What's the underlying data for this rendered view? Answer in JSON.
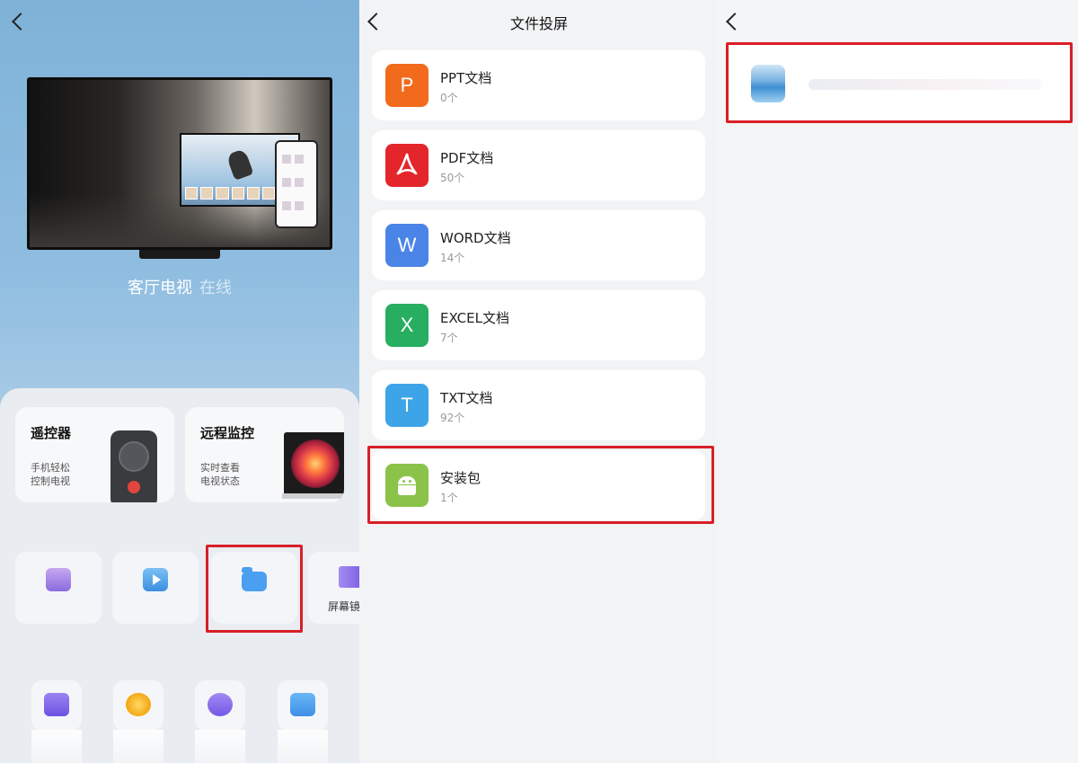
{
  "panel1": {
    "device": {
      "name": "客厅电视",
      "status": "在线"
    },
    "cards": [
      {
        "title": "遥控器",
        "subtitle_lines": [
          "手机轻松",
          "控制电视"
        ]
      },
      {
        "title": "远程监控",
        "subtitle_lines": [
          "实时查看",
          "电视状态"
        ]
      }
    ],
    "tiles": [
      {
        "icon": "image-icon",
        "label": ""
      },
      {
        "icon": "video-play-icon",
        "label": ""
      },
      {
        "icon": "folder-icon",
        "label": ""
      },
      {
        "icon": "screen-mirror-icon",
        "label": "屏幕镜"
      }
    ],
    "shortcuts": [
      {
        "icon": "tv-screen-icon"
      },
      {
        "icon": "magic-star-icon"
      },
      {
        "icon": "voice-icon"
      },
      {
        "icon": "video-camera-icon"
      }
    ]
  },
  "panel2": {
    "title": "文件投屏",
    "categories": [
      {
        "letter": "P",
        "name": "PPT文档",
        "count": "0个",
        "color": "#f26b1d"
      },
      {
        "letter": "",
        "name": "PDF文档",
        "count": "50个",
        "color": "#e3262b"
      },
      {
        "letter": "W",
        "name": "WORD文档",
        "count": "14个",
        "color": "#4b84e7"
      },
      {
        "letter": "X",
        "name": "EXCEL文档",
        "count": "7个",
        "color": "#27ae60"
      },
      {
        "letter": "T",
        "name": "TXT文档",
        "count": "92个",
        "color": "#3ea4e8"
      },
      {
        "letter": "",
        "name": "安装包",
        "count": "1个",
        "color": "#8bc34a"
      }
    ]
  },
  "panel3": {
    "items": [
      {
        "icon": "app-package-icon"
      }
    ]
  },
  "colors": {
    "highlight": "#d81f26"
  }
}
